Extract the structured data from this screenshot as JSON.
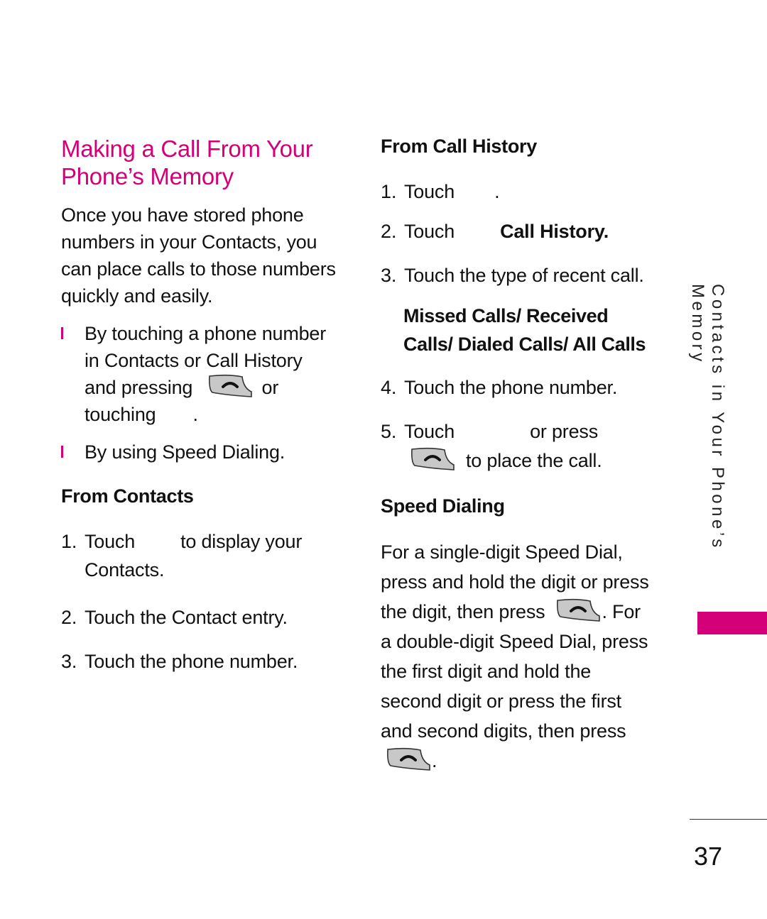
{
  "title_lines": [
    "Making a Call From Your",
    "Phone’s Memory"
  ],
  "intro_lines": [
    "Once you have stored phone",
    "numbers in your Contacts, you",
    "can place calls to those numbers",
    "quickly and easily."
  ],
  "bullets": [
    {
      "lines": [
        "By touching a phone number",
        "in Contacts or Call History"
      ],
      "line3_before": "and pressing",
      "line3_after": "or",
      "line4_before": "touching",
      "line4_after": "."
    },
    {
      "text": "By using Speed Dialing."
    }
  ],
  "from_contacts": {
    "heading": "From Contacts",
    "steps": [
      {
        "num": "1.",
        "before": "Touch",
        "after": "to display your",
        "cont": "Contacts."
      },
      {
        "num": "2.",
        "text": "Touch the Contact entry."
      },
      {
        "num": "3.",
        "text": "Touch the phone number."
      }
    ]
  },
  "from_call_history": {
    "heading": "From Call History",
    "steps": [
      {
        "num": "1.",
        "before": "Touch",
        "after": "."
      },
      {
        "num": "2.",
        "before": "Touch",
        "bold": "Call History."
      },
      {
        "num": "3.",
        "text": "Touch the type of recent call."
      },
      {
        "options_lines": [
          "Missed Calls/ Received",
          "Calls/ Dialed Calls/ All Calls"
        ]
      },
      {
        "num": "4.",
        "text": "Touch the phone number."
      },
      {
        "num": "5.",
        "before": "Touch",
        "after": "or press",
        "cont": "to place the call."
      }
    ]
  },
  "speed_dialing": {
    "heading": "Speed Dialing",
    "line1": "For a single-digit Speed Dial,",
    "line2": "press and hold the digit or press",
    "line3_before": "the digit, then press",
    "line3_after": ". For",
    "line4": "a double-digit Speed Dial, press",
    "line5": "the first digit and hold the",
    "line6": "second digit or press the first",
    "line7": "and second digits, then press",
    "line8_after": "."
  },
  "side_tab": "Contacts in Your Phone’s Memory",
  "page_number": "37",
  "colors": {
    "accent": "#d4007a",
    "key_fill": "#c8c8c8"
  }
}
